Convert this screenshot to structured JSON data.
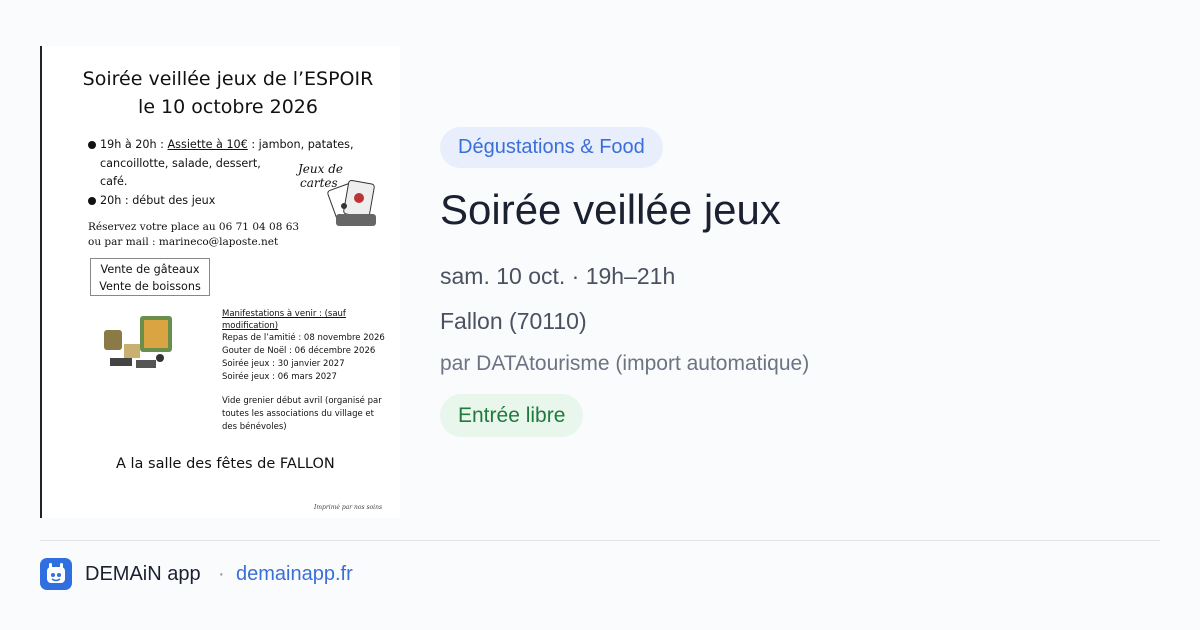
{
  "poster": {
    "title_line1": "Soirée veillée jeux de l’ESPOIR",
    "title_line2": "le 10 octobre 2026",
    "line1_time": "19h à 20h : ",
    "line1_underlined": "Assiette à 10€",
    "line1_rest": " : jambon, patates,",
    "line2": "cancoillotte, salade, dessert,",
    "line3": "café.",
    "line4": "20h : début des jeux",
    "hand_label_1": "Jeux de",
    "hand_label_2": "cartes",
    "reserve_line1": "Réservez votre place au 06 71 04 08 63",
    "reserve_line2": "ou par mail : marineco@laposte.net",
    "box_line1": "Vente de gâteaux",
    "box_line2": "Vente de boissons",
    "upcoming_title": "Manifestations à venir : (sauf modification)",
    "upcoming_items": [
      "Repas de l’amitié : 08 novembre 2026",
      "Gouter de Noël : 06 décembre 2026",
      "Soirée jeux : 30 janvier 2027",
      "Soirée jeux : 06 mars 2027"
    ],
    "vide_grenier_1": "Vide grenier début avril (organisé par",
    "vide_grenier_2": "toutes les associations du village et",
    "vide_grenier_3": "des bénévoles)",
    "venue": "A la salle des fêtes de FALLON",
    "printed": "Imprimé par nos soins"
  },
  "event": {
    "category": "Dégustations & Food",
    "title": "Soirée veillée jeux",
    "datetime": "sam. 10 oct. · 19h–21h",
    "location": "Fallon (70110)",
    "source": "par DATAtourisme (import automatique)",
    "price": "Entrée libre"
  },
  "footer": {
    "app_name": "DEMAiN app",
    "separator": "·",
    "link": "demainapp.fr",
    "logo_icon": "app-logo-icon"
  },
  "colors": {
    "accent": "#3b6fd8",
    "category_bg": "#e8eefc",
    "price_text": "#1f7a3d",
    "price_bg": "#e9f6ec"
  }
}
